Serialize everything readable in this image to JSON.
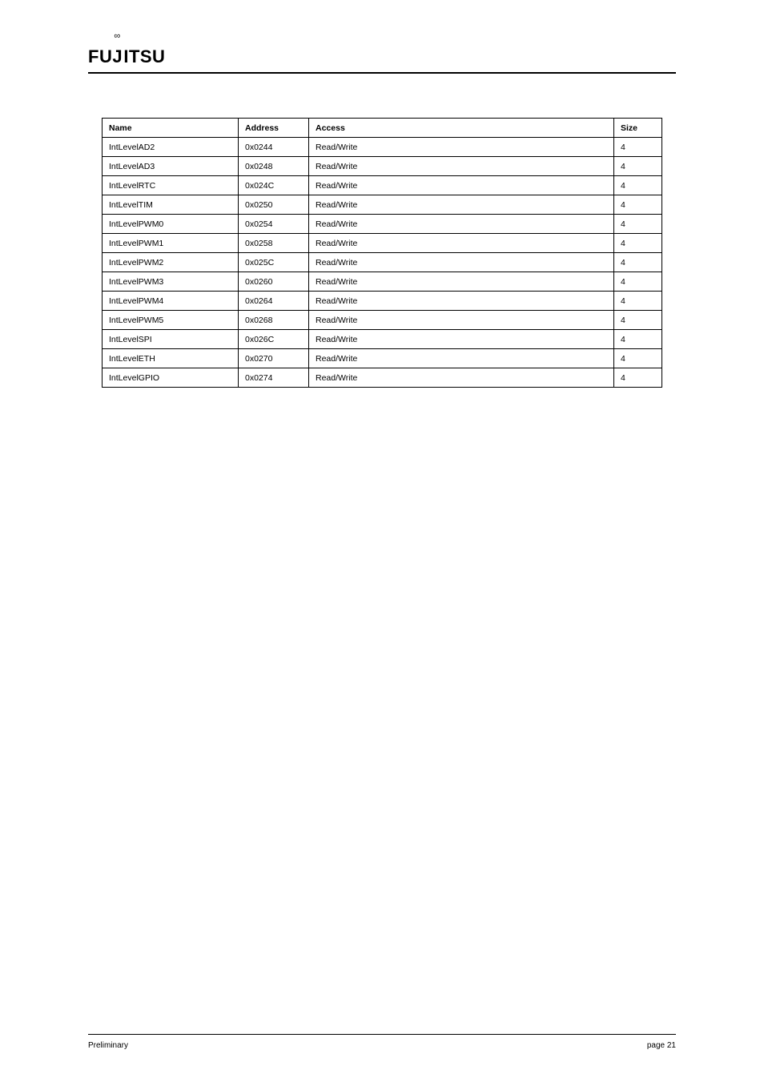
{
  "logo": {
    "left": "FU",
    "j": "J",
    "right": "ITSU"
  },
  "table": {
    "headers": {
      "name": "Name",
      "address": "Address",
      "access": "Access",
      "size": "Size"
    },
    "rows": [
      {
        "name": "IntLevelAD2",
        "address": "0x0244",
        "access": "Read/Write",
        "size": "4"
      },
      {
        "name": "IntLevelAD3",
        "address": "0x0248",
        "access": "Read/Write",
        "size": "4"
      },
      {
        "name": "IntLevelRTC",
        "address": "0x024C",
        "access": "Read/Write",
        "size": "4"
      },
      {
        "name": "IntLevelTIM",
        "address": "0x0250",
        "access": "Read/Write",
        "size": "4"
      },
      {
        "name": "IntLevelPWM0",
        "address": "0x0254",
        "access": "Read/Write",
        "size": "4"
      },
      {
        "name": "IntLevelPWM1",
        "address": "0x0258",
        "access": "Read/Write",
        "size": "4"
      },
      {
        "name": "IntLevelPWM2",
        "address": "0x025C",
        "access": "Read/Write",
        "size": "4"
      },
      {
        "name": "IntLevelPWM3",
        "address": "0x0260",
        "access": "Read/Write",
        "size": "4"
      },
      {
        "name": "IntLevelPWM4",
        "address": "0x0264",
        "access": "Read/Write",
        "size": "4"
      },
      {
        "name": "IntLevelPWM5",
        "address": "0x0268",
        "access": "Read/Write",
        "size": "4"
      },
      {
        "name": "IntLevelSPI",
        "address": "0x026C",
        "access": "Read/Write",
        "size": "4"
      },
      {
        "name": "IntLevelETH",
        "address": "0x0270",
        "access": "Read/Write",
        "size": "4"
      },
      {
        "name": "IntLevelGPIO",
        "address": "0x0274",
        "access": "Read/Write",
        "size": "4"
      }
    ]
  },
  "footer": {
    "left": "Preliminary",
    "right": "page 21"
  }
}
